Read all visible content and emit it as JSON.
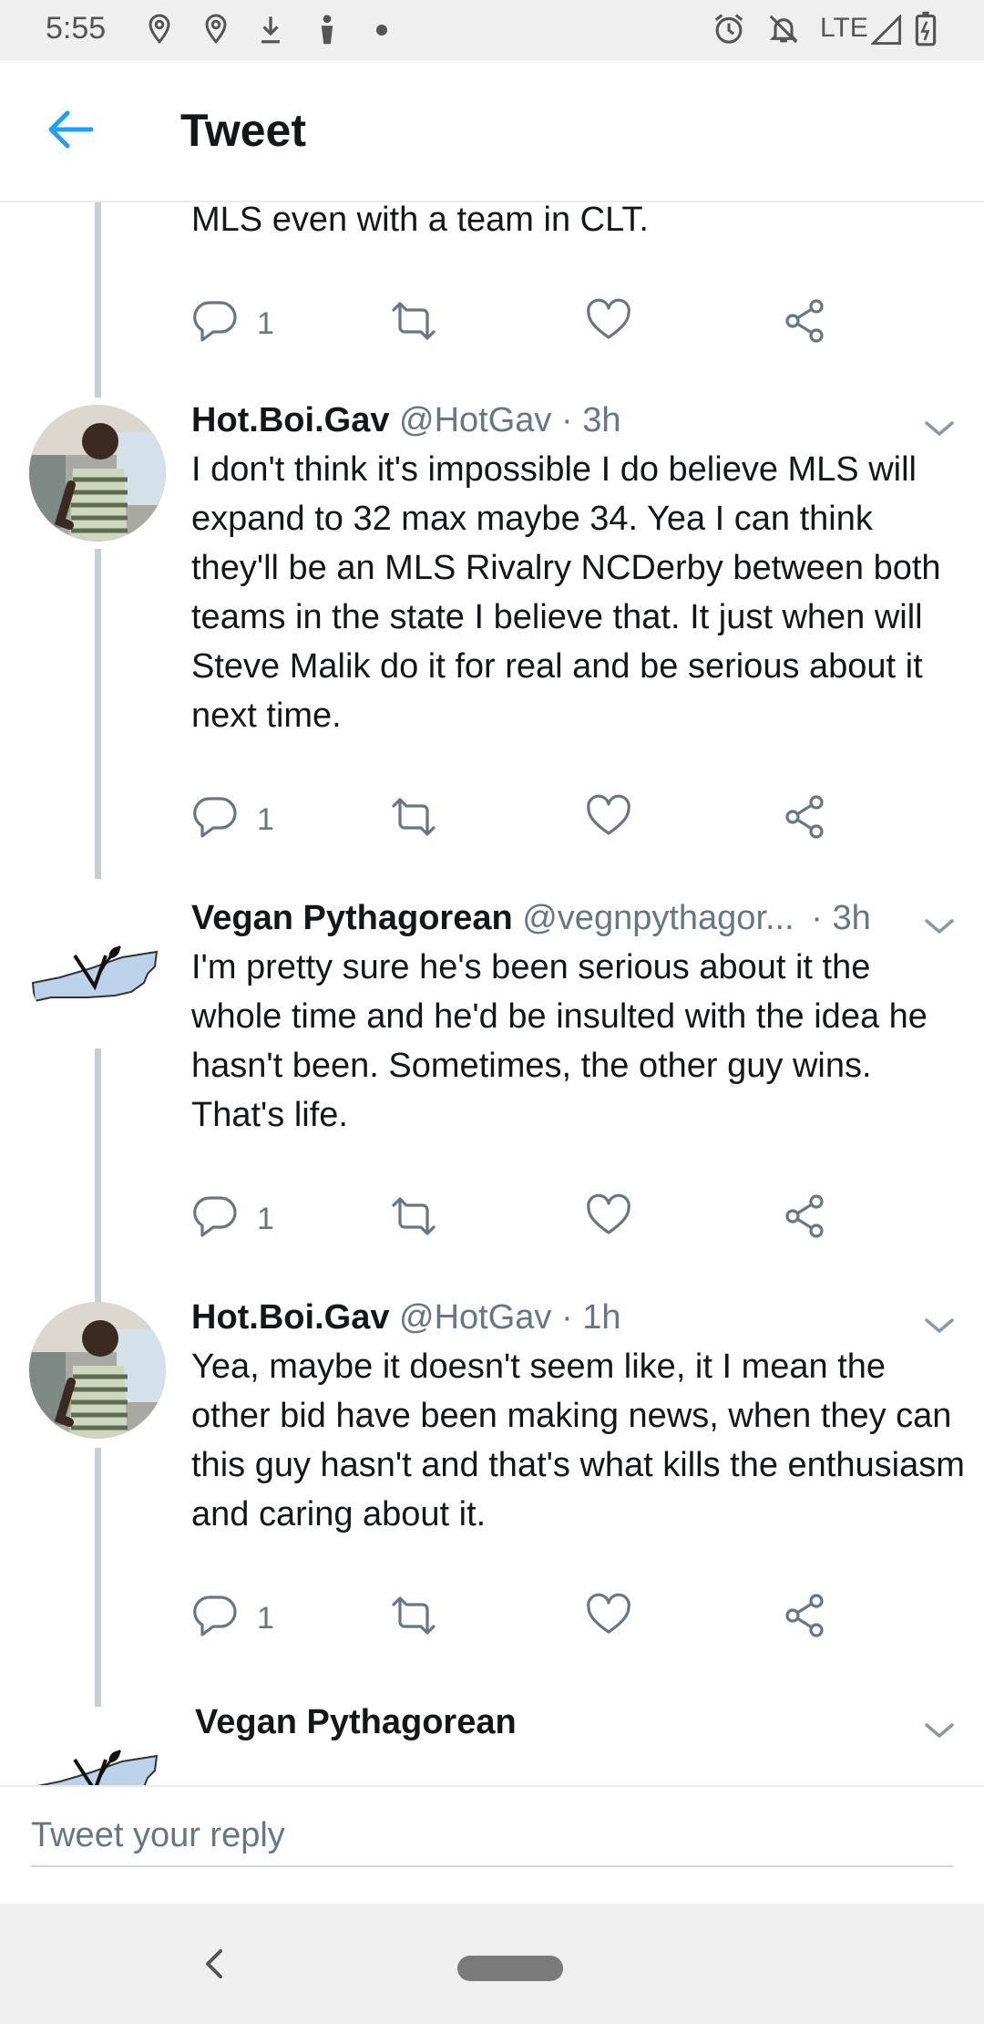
{
  "status_bar": {
    "time": "5:55",
    "network": "LTE",
    "icons": [
      "location-pin-icon",
      "location-pin-icon",
      "download-icon",
      "person-icon",
      "dot-icon",
      "alarm-icon",
      "notifications-off-icon",
      "signal-icon",
      "battery-charging-icon"
    ]
  },
  "header": {
    "title": "Tweet",
    "back_icon": "arrow-left-icon"
  },
  "tweets": [
    {
      "text": "MLS even with a team in CLT.",
      "reply_count": "1"
    },
    {
      "name": "Hot.Boi.Gav",
      "handle": "@HotGav · 3h",
      "text": "I don't think it's impossible I do believe MLS will expand to 32 max maybe 34. Yea I can think they'll be an MLS Rivalry NCDerby between both teams in the state I believe that. It just when will Steve Malik do it for real and be serious about it next time.",
      "reply_count": "1"
    },
    {
      "name": "Vegan Pythagorean",
      "handle": "@vegnpythagor...",
      "time": "· 3h",
      "text": "I'm pretty sure he's been serious about it the whole time and he'd be insulted with the idea he hasn't been. Sometimes, the other guy wins. That's life.",
      "reply_count": "1"
    },
    {
      "name": "Hot.Boi.Gav",
      "handle": "@HotGav · 1h",
      "text": "Yea, maybe it doesn't seem like, it I mean the other bid have been making news, when they can this guy hasn't and that's what kills the enthusiasm and caring about it.",
      "reply_count": "1"
    },
    {
      "name": "Vegan Pythagorean"
    }
  ],
  "reply_bar": {
    "placeholder": "Tweet your reply"
  },
  "colors": {
    "accent": "#1da1f2",
    "text": "#14171a",
    "muted": "#657786",
    "thread_line": "#c4cfd6"
  }
}
